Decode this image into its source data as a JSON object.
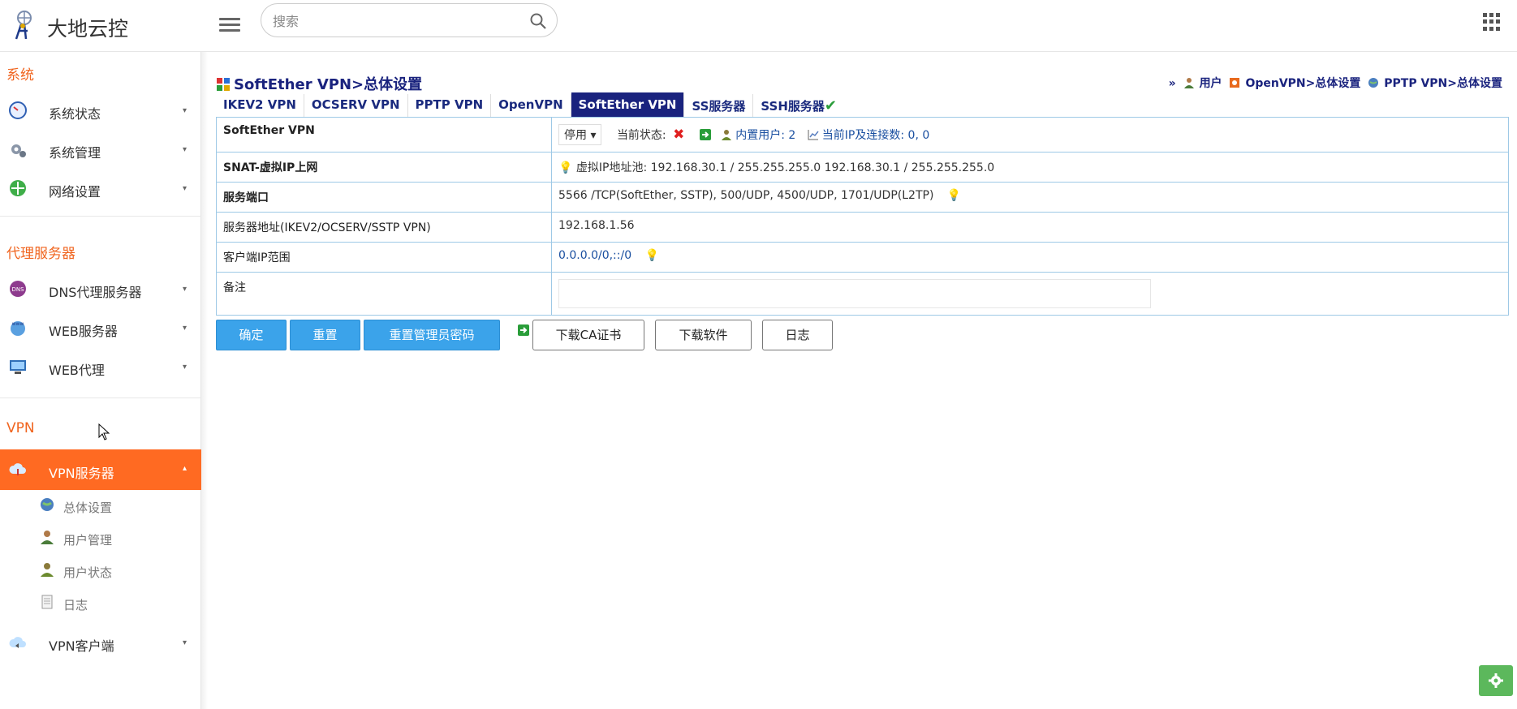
{
  "header": {
    "brand": "大地云控",
    "search_placeholder": "搜索"
  },
  "sidebar": {
    "sections": [
      {
        "title": "系统"
      },
      {
        "title": "代理服务器"
      },
      {
        "title": "VPN"
      }
    ],
    "items": [
      {
        "label": "系统状态"
      },
      {
        "label": "系统管理"
      },
      {
        "label": "网络设置"
      },
      {
        "label": "DNS代理服务器"
      },
      {
        "label": "WEB服务器"
      },
      {
        "label": "WEB代理"
      },
      {
        "label": "VPN服务器"
      },
      {
        "label": "VPN客户端"
      }
    ],
    "subitems": [
      {
        "label": "总体设置"
      },
      {
        "label": "用户管理"
      },
      {
        "label": "用户状态"
      },
      {
        "label": "日志"
      }
    ]
  },
  "main": {
    "title": "SoftEther VPN>总体设置",
    "crumbs": {
      "prefix": "»",
      "user": "用户",
      "openvpn": "OpenVPN>总体设置",
      "pptp": "PPTP VPN>总体设置"
    },
    "tabs": [
      {
        "label": "IKEV2 VPN"
      },
      {
        "label": "OCSERV VPN"
      },
      {
        "label": "PPTP VPN"
      },
      {
        "label": "OpenVPN"
      },
      {
        "label": "SoftEther VPN"
      },
      {
        "label": "SS服务器"
      },
      {
        "label": "SSH服务器"
      }
    ],
    "rows": {
      "softether": {
        "key": "SoftEther VPN",
        "select_value": "停用",
        "status_label": "当前状态:",
        "builtin_users": "内置用户: 2",
        "ip_conn": "当前IP及连接数: 0, 0"
      },
      "snat": {
        "key": "SNAT-虚拟IP上网",
        "value": "虚拟IP地址池: 192.168.30.1 / 255.255.255.0 192.168.30.1 / 255.255.255.0"
      },
      "port": {
        "key": "服务端口",
        "value": "5566 /TCP(SoftEther, SSTP), 500/UDP, 4500/UDP, 1701/UDP(L2TP)"
      },
      "server_addr": {
        "key": "服务器地址(IKEV2/OCSERV/SSTP VPN)",
        "value": "192.168.1.56"
      },
      "client_ip": {
        "key": "客户端IP范围",
        "value": "0.0.0.0/0,::/0"
      },
      "remark": {
        "key": "备注",
        "value": ""
      }
    },
    "buttons": {
      "confirm": "确定",
      "reset": "重置",
      "reset_admin_pw": "重置管理员密码",
      "download_ca": "下载CA证书",
      "download_software": "下载软件",
      "log": "日志"
    }
  },
  "colors": {
    "accent_orange": "#ff6a22",
    "nav_blue": "#1a237e",
    "primary_button": "#3ba3ea",
    "fab_green": "#5cb85c"
  }
}
